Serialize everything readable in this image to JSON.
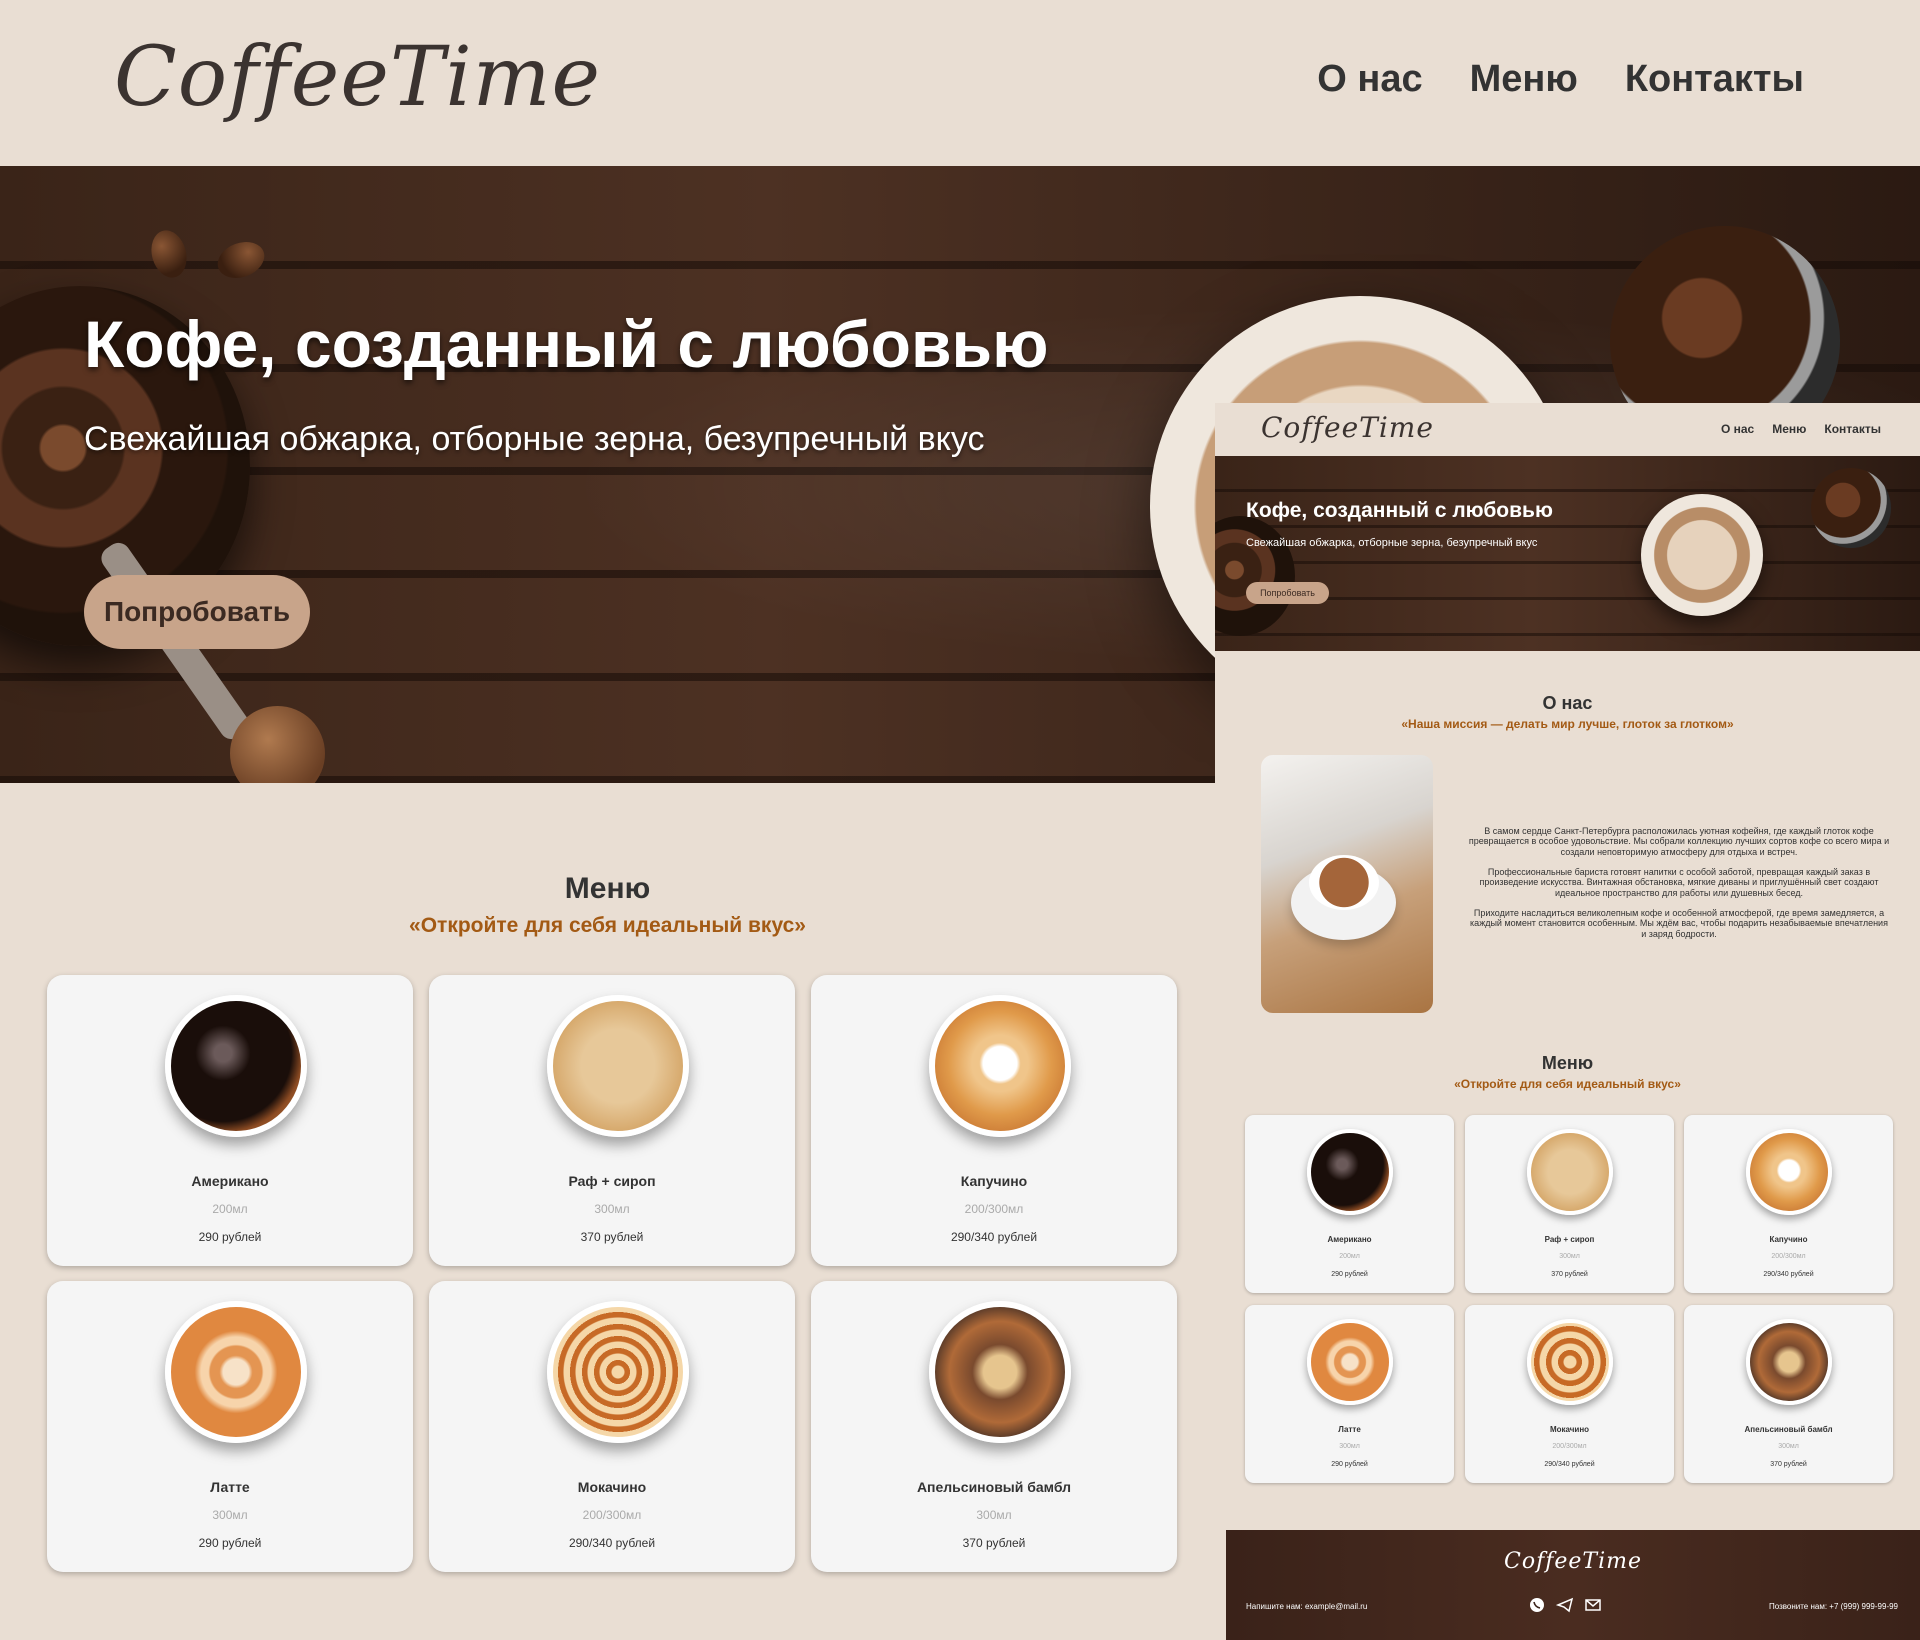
{
  "header": {
    "logo": "CoffeeTime",
    "nav": [
      "О нас",
      "Меню",
      "Контакты"
    ]
  },
  "hero": {
    "title": "Кофе, созданный с любовью",
    "subtitle": "Свежайшая обжарка, отборные зерна, безупречный вкус",
    "button": "Попробовать"
  },
  "menu": {
    "title": "Меню",
    "subtitle": "«Откройте для себя идеальный вкус»",
    "items": [
      {
        "name": "Американо",
        "volume": "200мл",
        "price": "290 рублей"
      },
      {
        "name": "Раф + сироп",
        "volume": "300мл",
        "price": "370 рублей"
      },
      {
        "name": "Капучино",
        "volume": "200/300мл",
        "price": "290/340 рублей"
      },
      {
        "name": "Латте",
        "volume": "300мл",
        "price": "290 рублей"
      },
      {
        "name": "Мокачино",
        "volume": "200/300мл",
        "price": "290/340 рублей"
      },
      {
        "name": "Апельсиновый бамбл",
        "volume": "300мл",
        "price": "370 рублей"
      }
    ]
  },
  "mini": {
    "about_title": "О нас",
    "about_subtitle": "«Наша миссия — делать мир лучше, глоток за глотком»",
    "about_p1": "В самом сердце Санкт-Петербурга расположилась уютная кофейня, где каждый глоток кофе превращается в особое удовольствие. Мы собрали коллекцию лучших сортов кофе со всего мира и создали неповторимую атмосферу для отдыха и встреч.",
    "about_p2": "Профессиональные бариста готовят напитки с особой заботой, превращая каждый заказ в произведение искусства. Винтажная обстановка, мягкие диваны и приглушённый свет создают идеальное пространство для работы или душевных бесед.",
    "about_p3": "Приходите насладиться великолепным кофе и особенной атмосферой, где время замедляется, а каждый момент становится особенным. Мы ждём вас, чтобы подарить незабываемые впечатления и заряд бодрости.",
    "menu_items": [
      {
        "name": "Американо",
        "volume": "200мл",
        "price": "290 рублей"
      },
      {
        "name": "Раф + сироп",
        "volume": "300мл",
        "price": "370 рублей"
      },
      {
        "name": "Капучино",
        "volume": "200/300мл",
        "price": "290/340 рублей"
      },
      {
        "name": "Латте",
        "volume": "300мл",
        "price": "290 рублей"
      },
      {
        "name": "Мокачино",
        "volume": "200/300мл",
        "price": "290/340 рублей"
      },
      {
        "name": "Апельсиновый бамбл",
        "volume": "300мл",
        "price": "370 рублей"
      }
    ],
    "footer": {
      "logo": "CoffeeTime",
      "mail": "Напишите нам: example@mail.ru",
      "phone": "Позвоните нам: +7 (999) 999-99-99",
      "icons": [
        "whatsapp-icon",
        "telegram-icon",
        "mail-icon"
      ]
    }
  },
  "colors": {
    "background": "#e9ded3",
    "accent": "#a35a14",
    "button": "#c8a48a",
    "hero_dark": "#3a2418"
  }
}
